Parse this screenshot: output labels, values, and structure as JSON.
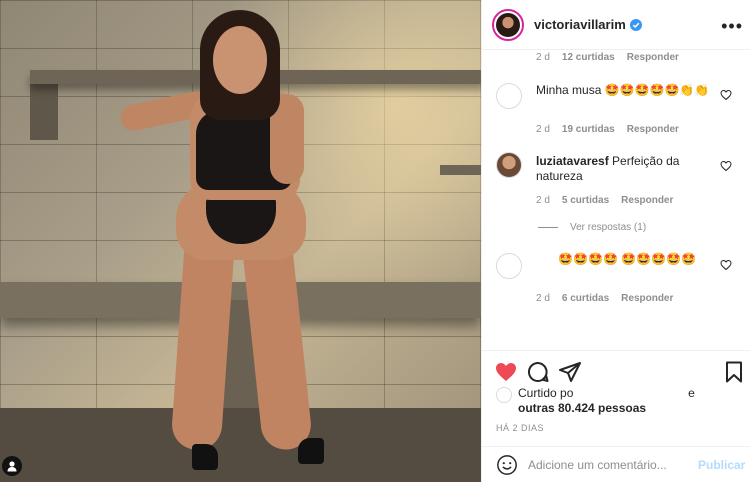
{
  "post": {
    "username": "victoriavillarim",
    "verified": true,
    "more_icon": "more-horizontal-icon",
    "photo_alt": ""
  },
  "comments": [
    {
      "ago": "2 d",
      "likes": "12 curtidas",
      "reply": "Responder"
    },
    {
      "user": "",
      "text": "Minha musa 🤩🤩🤩🤩🤩👏👏",
      "ago": "2 d",
      "likes": "19 curtidas",
      "reply": "Responder"
    },
    {
      "user": "luziatavaresf",
      "text": "Perfeição da natureza",
      "ago": "2 d",
      "likes": "5 curtidas",
      "reply": "Responder",
      "view_replies": "Ver respostas (1)"
    },
    {
      "user": "",
      "text": "🤩🤩🤩🤩 🤩🤩🤩🤩🤩",
      "ago": "2 d",
      "likes": "6 curtidas",
      "reply": "Responder"
    }
  ],
  "likes": {
    "prefix": "Curtido po",
    "suffix": "e",
    "count_text": "outras 80.424 pessoas"
  },
  "time_ago": "HÁ 2 DIAS",
  "add_comment": {
    "placeholder": "Adicione um comentário...",
    "post_label": "Publicar"
  },
  "colors": {
    "like_red": "#ed4956",
    "link_blue": "#0095f6",
    "post_disabled": "#b3dbff",
    "verified_blue": "#3897f0"
  }
}
